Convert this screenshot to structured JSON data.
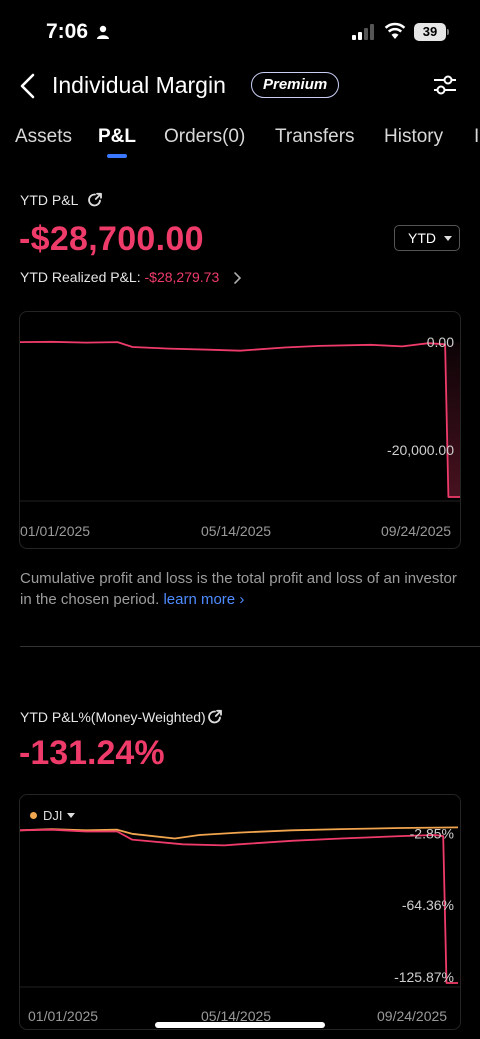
{
  "status_bar": {
    "time": "7:06",
    "battery": "39"
  },
  "nav": {
    "title": "Individual Margin",
    "badge": "Premium"
  },
  "tabs": [
    {
      "label": "Assets",
      "active": false
    },
    {
      "label": "P&L",
      "active": true
    },
    {
      "label": "Orders(0)",
      "active": false
    },
    {
      "label": "Transfers",
      "active": false
    },
    {
      "label": "History",
      "active": false
    }
  ],
  "pnl": {
    "label": "YTD P&L",
    "value": "-$28,700.00",
    "period": "YTD",
    "realized_label": "YTD Realized P&L:",
    "realized_value": "-$28,279.73",
    "description": "Cumulative profit and loss is the total profit and loss of an investor in the chosen period.",
    "learn_more": "learn more"
  },
  "pnl_pct": {
    "label": "YTD P&L%(Money-Weighted)",
    "value": "-131.24%",
    "benchmark": "DJI"
  },
  "colors": {
    "negative": "#ef3b6a",
    "benchmark": "#f0a54e",
    "accent": "#3a78ff",
    "positive": "#2bd0b4"
  },
  "chart_data": [
    {
      "type": "line",
      "title": "YTD P&L",
      "x_ticks": [
        "01/01/2025",
        "05/14/2025",
        "09/24/2025"
      ],
      "y_ticks": [
        "0.00",
        "-20,000.00"
      ],
      "ylim": [
        -28700,
        1500
      ],
      "series": [
        {
          "values": [
            [
              "2025-01-01",
              0
            ],
            [
              "2025-01-20",
              50
            ],
            [
              "2025-02-10",
              -100
            ],
            [
              "2025-03-01",
              0
            ],
            [
              "2025-03-10",
              -900
            ],
            [
              "2025-04-01",
              -1200
            ],
            [
              "2025-04-25",
              -1400
            ],
            [
              "2025-05-14",
              -1600
            ],
            [
              "2025-06-10",
              -1000
            ],
            [
              "2025-07-01",
              -700
            ],
            [
              "2025-08-01",
              -500
            ],
            [
              "2025-08-20",
              -800
            ],
            [
              "2025-09-05",
              -200
            ],
            [
              "2025-09-15",
              -400
            ],
            [
              "2025-09-17",
              -28700
            ],
            [
              "2025-09-24",
              -28700
            ]
          ]
        }
      ]
    },
    {
      "type": "line",
      "title": "YTD P&L%(Money-Weighted)",
      "x_ticks": [
        "01/01/2025",
        "05/14/2025",
        "09/24/2025"
      ],
      "y_ticks": [
        "-2.85%",
        "-64.36%",
        "-125.87%"
      ],
      "ylim": [
        -131.24,
        8
      ],
      "series": [
        {
          "name": "DJI",
          "values": [
            [
              "2025-01-01",
              0
            ],
            [
              "2025-01-20",
              1
            ],
            [
              "2025-02-10",
              0
            ],
            [
              "2025-03-01",
              0.5
            ],
            [
              "2025-03-10",
              -3
            ],
            [
              "2025-04-05",
              -7
            ],
            [
              "2025-04-20",
              -4
            ],
            [
              "2025-05-14",
              -2
            ],
            [
              "2025-06-15",
              0
            ],
            [
              "2025-07-15",
              1
            ],
            [
              "2025-08-20",
              2
            ],
            [
              "2025-09-24",
              2.5
            ]
          ]
        },
        {
          "values": [
            [
              "2025-01-01",
              0
            ],
            [
              "2025-01-20",
              0.5
            ],
            [
              "2025-02-10",
              -1
            ],
            [
              "2025-03-01",
              -1
            ],
            [
              "2025-03-10",
              -8
            ],
            [
              "2025-04-10",
              -12
            ],
            [
              "2025-05-05",
              -13
            ],
            [
              "2025-05-14",
              -12
            ],
            [
              "2025-06-15",
              -9
            ],
            [
              "2025-07-15",
              -7
            ],
            [
              "2025-08-20",
              -5
            ],
            [
              "2025-09-10",
              -4
            ],
            [
              "2025-09-15",
              -5
            ],
            [
              "2025-09-17",
              -131.24
            ],
            [
              "2025-09-24",
              -131.24
            ]
          ]
        }
      ]
    }
  ]
}
